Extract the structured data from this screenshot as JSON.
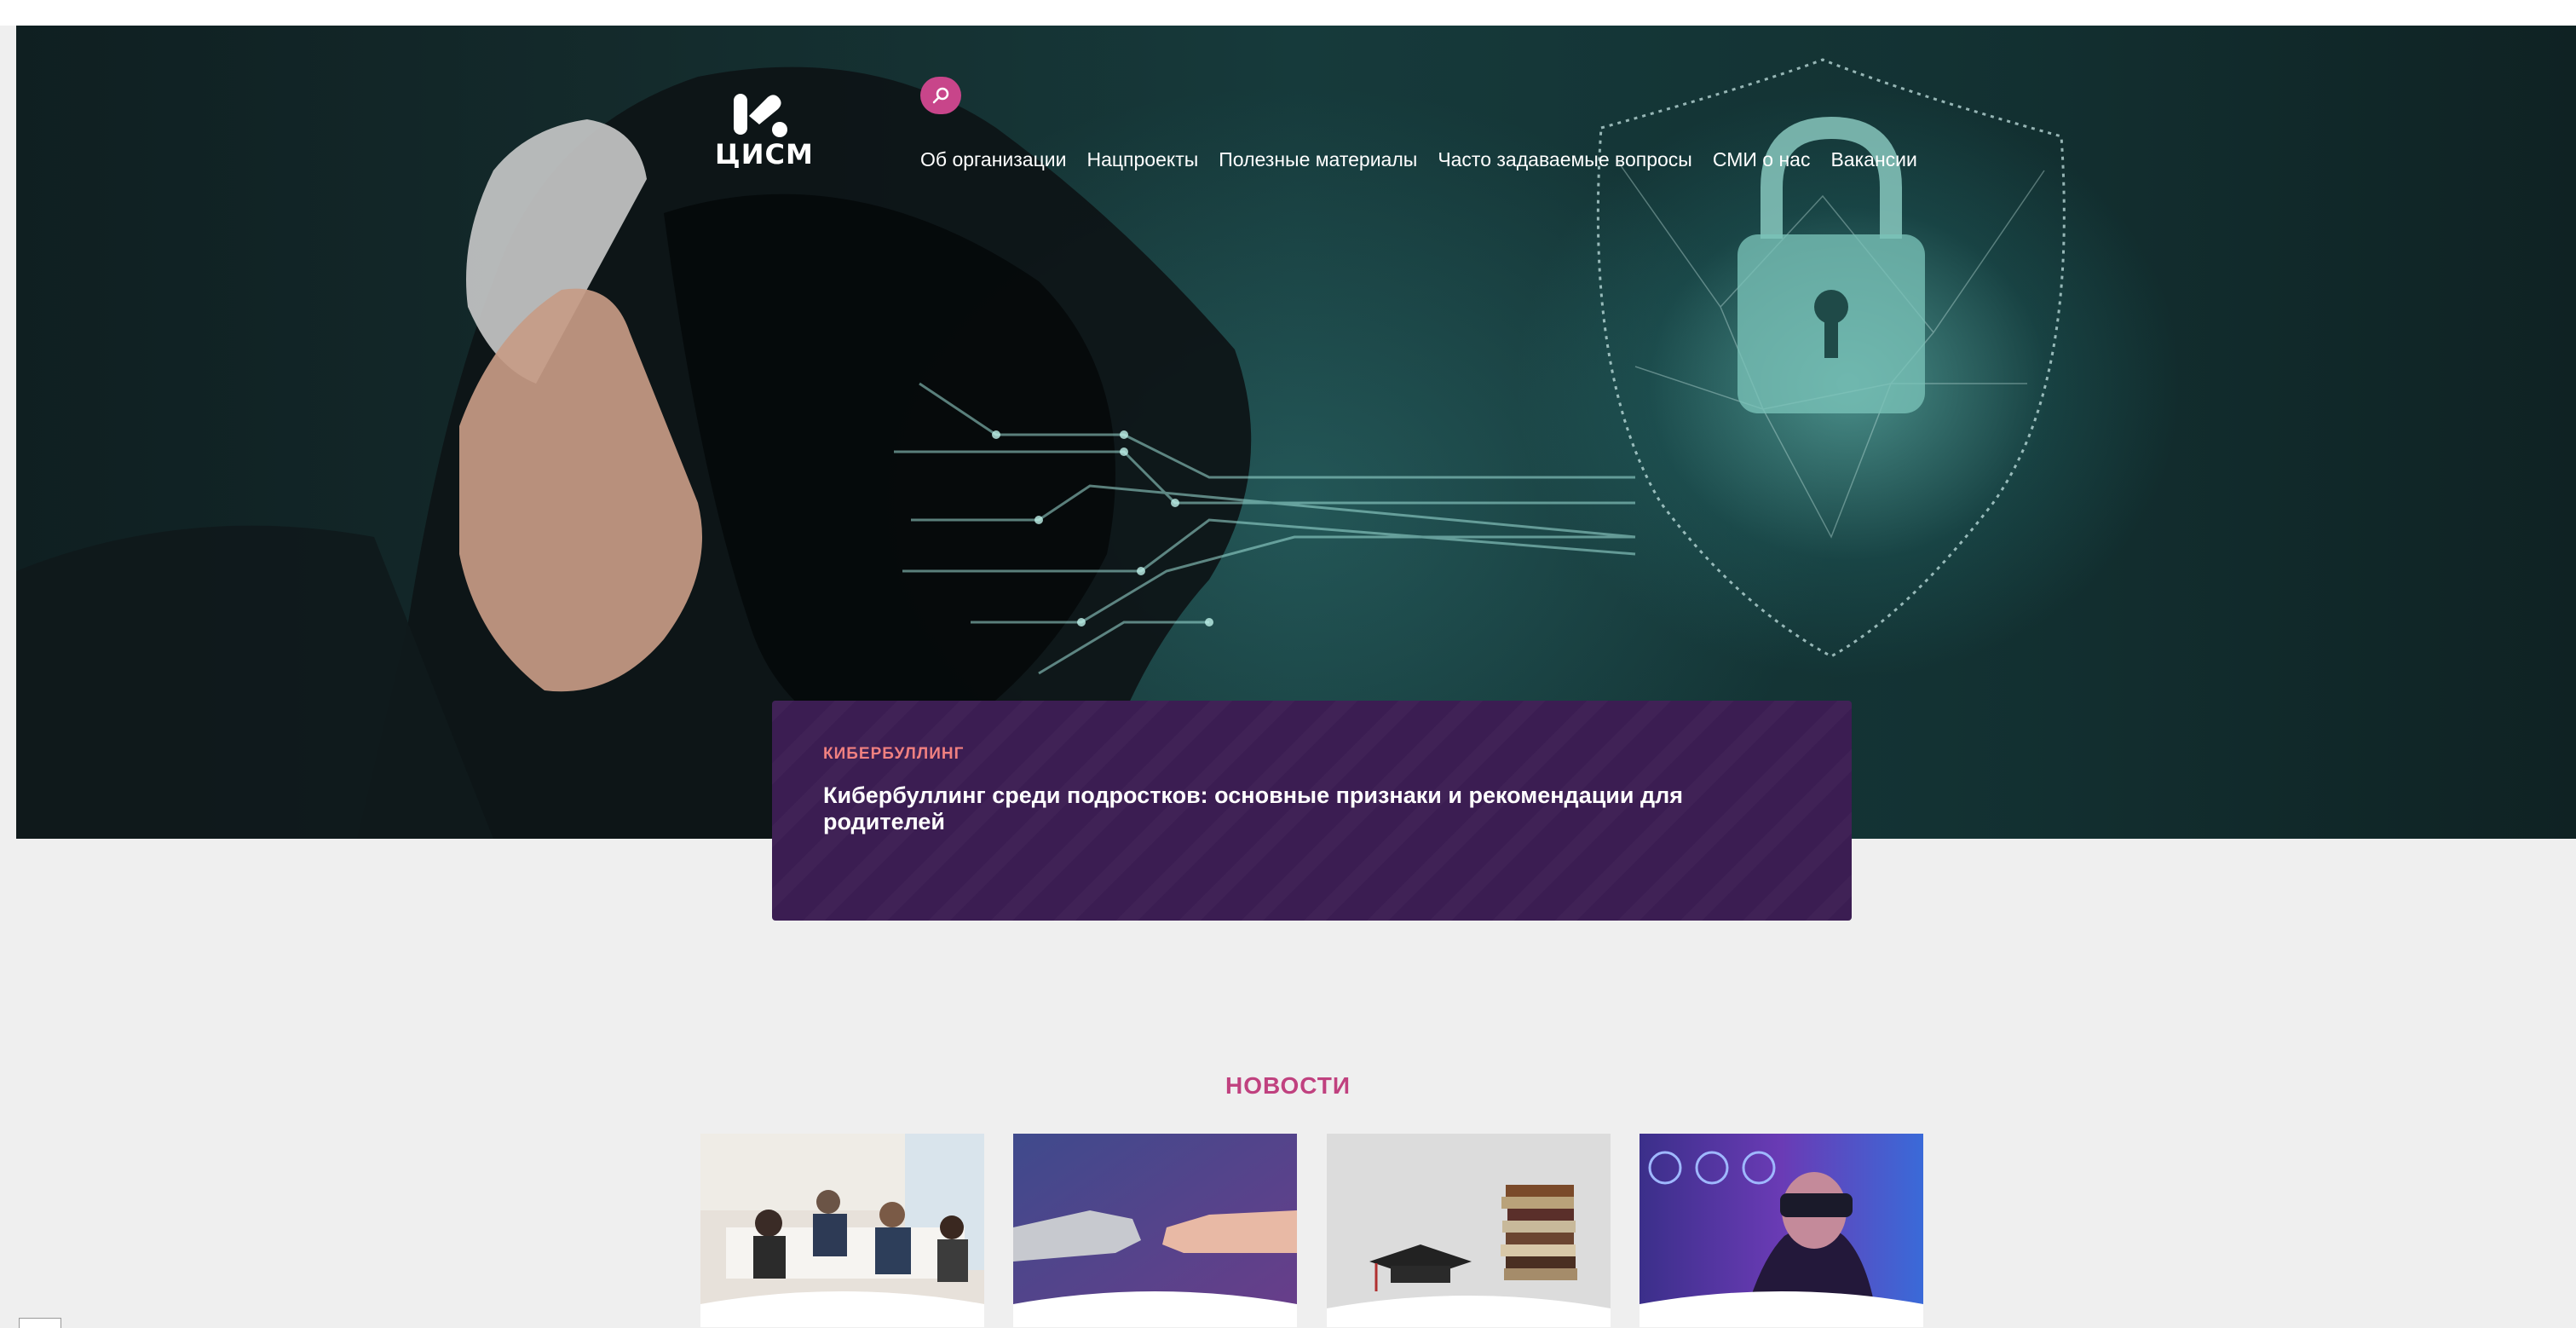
{
  "header": {
    "logo_text": "ЦИСМ",
    "search_icon": "search-icon",
    "nav": [
      {
        "label": "Об организации"
      },
      {
        "label": "Нацпроекты"
      },
      {
        "label": "Полезные материалы"
      },
      {
        "label": "Часто задаваемые вопросы"
      },
      {
        "label": "СМИ о нас"
      },
      {
        "label": "Вакансии"
      }
    ]
  },
  "feature": {
    "tag": "КИБЕРБУЛЛИНГ",
    "title": "Кибербуллинг среди подростков: основные признаки и рекомендации для родителей"
  },
  "news": {
    "heading": "НОВОСТИ"
  },
  "colors": {
    "accent": "#c8458a",
    "feature_bg": "#3b1d52",
    "tag": "#f08080",
    "news_heading": "#c0417f"
  }
}
